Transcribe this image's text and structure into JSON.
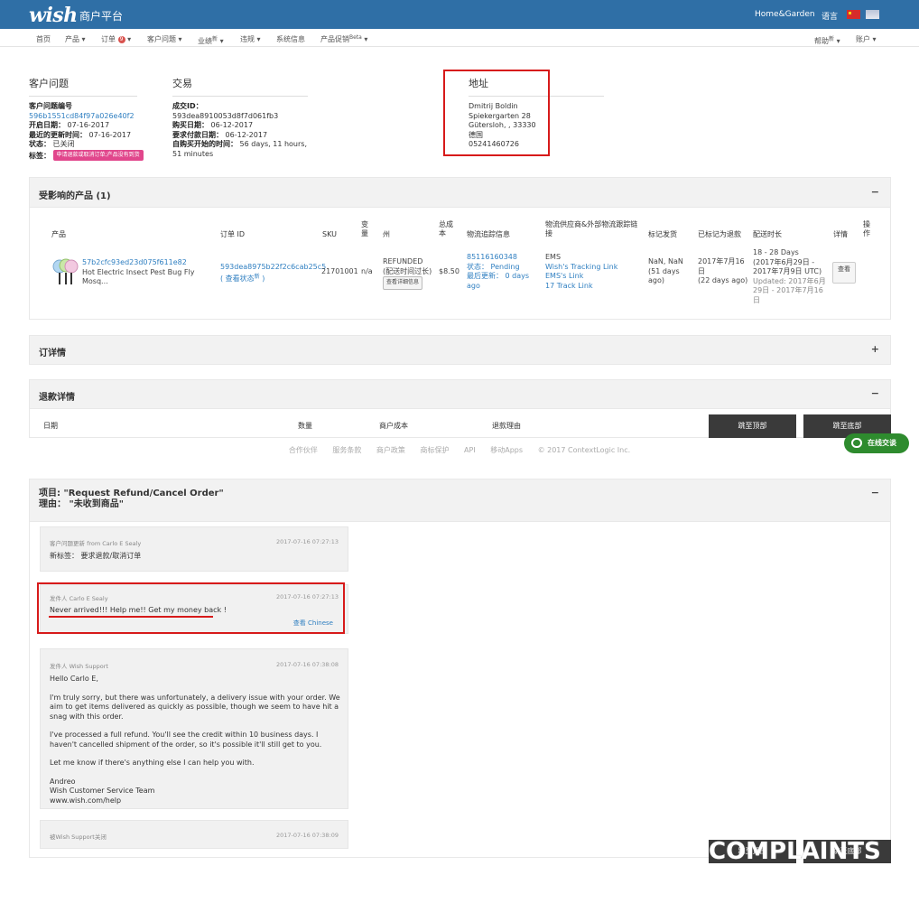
{
  "header": {
    "logo": "wish",
    "portal": "商户平台",
    "store": "Home&Garden",
    "language": "语言"
  },
  "nav": {
    "home": "首页",
    "products": "产品",
    "orders": "订单",
    "orders_badge": "9",
    "customer_issues": "客户问题",
    "performance": "业绩",
    "performance_sup": "新",
    "violations": "违规",
    "system_info": "系统信息",
    "product_boost": "产品促销",
    "product_boost_sup": "Beta",
    "help": "帮助",
    "help_sup": "新",
    "account": "账户"
  },
  "issue": {
    "title": "客户问题",
    "id_label": "客户问题编号",
    "id_value": "596b1551cd84f97a026e40f2",
    "open_label": "开启日期：",
    "open_value": "07-16-2017",
    "update_label": "最近的更新时间：",
    "update_value": "07-16-2017",
    "status_label": "状态：",
    "status_value": "已关闭",
    "tag_label": "标签：",
    "tag_value": "申请退款或取消订单;产品没有到货"
  },
  "transaction": {
    "title": "交易",
    "deal_label": "成交ID：",
    "deal_value": "593dea8910053d8f7d061fb3",
    "buy_label": "购买日期：",
    "buy_value": "06-12-2017",
    "pay_label": "要求付款日期：",
    "pay_value": "06-12-2017",
    "since_label": "自购买开始的时间：",
    "since_value": "56 days, 11 hours, 51 minutes"
  },
  "address": {
    "title": "地址",
    "name": "Dmitrij Boldin",
    "street": "Spiekergarten 28",
    "city": "Gütersloh, , 33330",
    "country": "德国",
    "phone": "05241460726"
  },
  "affected": {
    "title": "受影响的产品 (1)",
    "toggle": "−",
    "headers": {
      "product": "产品",
      "order_id": "订单 ID",
      "sku": "SKU",
      "variant": "变量",
      "state": "州",
      "total": "总成本",
      "tracking": "物流追踪信息",
      "carrier": "物流供应商&外部物流跟踪链接",
      "mark_ship": "标记发货",
      "marked_refund": "已标记为退款",
      "ship_time": "配送时长",
      "details": "详情",
      "actions": "操作"
    },
    "row": {
      "product_id": "57b2cfc93ed23d075f611e82",
      "product_name": "Hot Electric Insect Pest Bug Fly Mosq...",
      "order_id": "593dea8975b22f2c6cab25c5",
      "view_status": "( 查看状态",
      "view_status_sup": "新",
      "view_status_close": ")",
      "sku": "21701001",
      "variant": "n/a",
      "state": "REFUNDED",
      "state_sub": "(配送时间过长)",
      "state_btn": "查看详细信息",
      "total": "$8.50",
      "tracking_no": "85116160348",
      "tracking_status": "状态： Pending",
      "tracking_update": "最后更新： 0 days ago",
      "carrier": "EMS",
      "link1": "Wish's Tracking Link",
      "link2": "EMS's Link",
      "link3": "17 Track Link",
      "mark_ship": "NaN, NaN (51 days ago)",
      "refund_date": "2017年7月16日",
      "refund_ago": "(22 days ago)",
      "ship_range": "18 - 28 Days",
      "ship_dates": "(2017年6月29日 - 2017年7月9日 UTC)",
      "ship_updated": "Updated: 2017年6月29日 - 2017年7月16日",
      "view_btn": "查看"
    }
  },
  "order_detail": {
    "title": "订详情",
    "toggle": "+"
  },
  "refund_detail": {
    "title": "退款详情",
    "toggle": "−",
    "col_date": "日期",
    "col_qty": "数量",
    "col_cost": "商户成本",
    "col_reason": "退款理由"
  },
  "buttons": {
    "top": "跳至顶部",
    "bottom": "跳至底部"
  },
  "footer": {
    "partners": "合作伙伴",
    "terms": "服务条款",
    "policy": "商户政策",
    "brand": "商标保护",
    "api": "API",
    "apps": "移动Apps",
    "copyright": "© 2017 ContextLogic Inc."
  },
  "chat": {
    "label": "在线交谈"
  },
  "ticket": {
    "subject": "项目: \"Request Refund/Cancel Order\"",
    "reason": "理由： \"未收到商品\"",
    "toggle": "−"
  },
  "messages": [
    {
      "from": "客户问题更新 from Carlo E Sealy",
      "time": "2017-07-16 07:27:13",
      "body": "新标签： 要求退款/取消订单"
    },
    {
      "from": "发件人 Carlo E Sealy",
      "time": "2017-07-16 07:27:13",
      "body": "Never arrived!!! Help me!! Get my money back !",
      "translate": "查看 Chinese"
    },
    {
      "from": "发件人 Wish Support",
      "time": "2017-07-16 07:38:08",
      "p1": "Hello Carlo E,",
      "p2": "I'm truly sorry, but there was unfortunately, a delivery issue with your order. We aim to get items delivered as quickly as possible, though we seem to have hit a snag with this order.",
      "p3": "I've processed a full refund. You'll see the credit within 10 business days. I haven't cancelled shipment of the order, so it's possible it'll still get to you.",
      "p4": "Let me know if there's anything else I can help you with.",
      "sig1": "Andreo",
      "sig2": "Wish Customer Service Team",
      "sig3": "www.wish.com/help"
    },
    {
      "from": "被Wish Support关闭",
      "time": "2017-07-16 07:38:09"
    }
  ],
  "watermark": "COMPLAINTS"
}
